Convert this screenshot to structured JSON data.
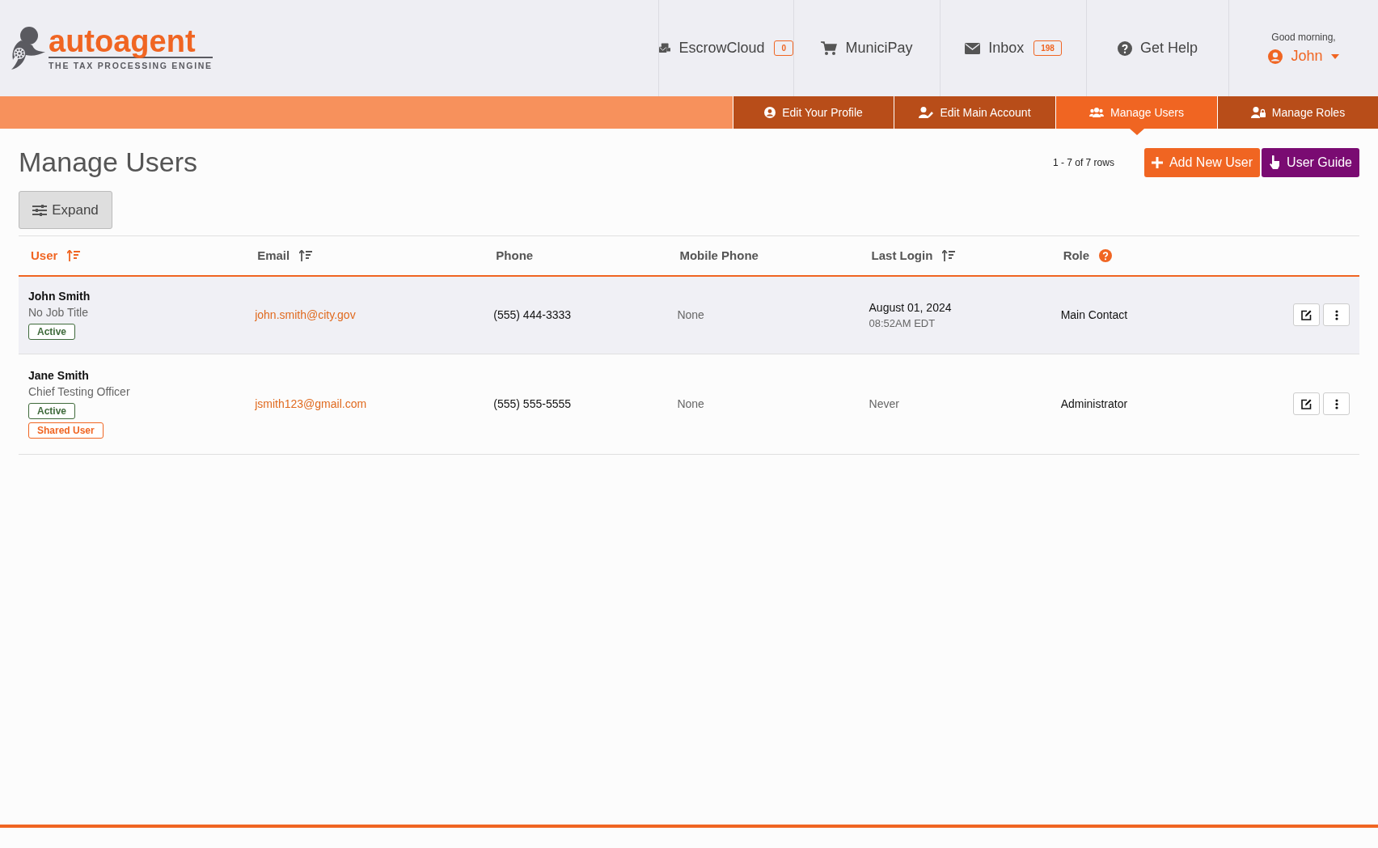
{
  "logo": {
    "name": "autoagent",
    "tagline": "THE TAX PROCESSING ENGINE"
  },
  "top_nav": [
    {
      "kind": "escrow",
      "label": "EscrowCloud",
      "badge": "0"
    },
    {
      "kind": "cart",
      "label": "MuniciPay"
    },
    {
      "kind": "mail",
      "label": "Inbox",
      "badge": "198"
    },
    {
      "kind": "help",
      "label": "Get Help"
    }
  ],
  "user_menu": {
    "greeting": "Good morning,",
    "name": "John"
  },
  "tabs": [
    {
      "kind": "profile",
      "label": "Edit Your Profile",
      "selected": false
    },
    {
      "kind": "account",
      "label": "Edit Main Account",
      "selected": false
    },
    {
      "kind": "users",
      "label": "Manage Users",
      "selected": true
    },
    {
      "kind": "roles",
      "label": "Manage Roles",
      "selected": false
    }
  ],
  "page_title": "Manage Users",
  "row_count": "1 - 7 of 7 rows",
  "buttons": [
    {
      "kind": "add",
      "label": "Add New User"
    },
    {
      "kind": "guide",
      "label": "User Guide"
    }
  ],
  "expand_button": "Expand",
  "table": {
    "columns": [
      {
        "label": "User",
        "kind": "sort",
        "selected": true
      },
      {
        "label": "Email",
        "kind": "sort",
        "selected": false
      },
      {
        "label": "Phone",
        "kind": "plain",
        "selected": false
      },
      {
        "label": "Mobile Phone",
        "kind": "plain",
        "selected": false
      },
      {
        "label": "Last Login",
        "kind": "sort",
        "selected": false
      },
      {
        "label": "Role",
        "kind": "help",
        "selected": false
      }
    ],
    "rows": [
      {
        "highlighted": true,
        "name": "John Smith",
        "job_title": "No Job Title",
        "badges": [
          {
            "kind": "status",
            "label": "Active"
          }
        ],
        "email": "john.smith@city.gov",
        "phone": "(555) 444-3333",
        "mobile_phone": "None",
        "last_login": {
          "date": "August 01, 2024",
          "time": "08:52AM EDT"
        },
        "role": "Main Contact"
      },
      {
        "highlighted": false,
        "name": "Jane Smith",
        "job_title": "Chief Testing Officer",
        "badges": [
          {
            "kind": "status",
            "label": "Active"
          },
          {
            "kind": "shared",
            "label": "Shared User"
          }
        ],
        "email": "jsmith123@gmail.com",
        "phone": "(555) 555-5555",
        "mobile_phone": "None",
        "last_login": {
          "never": "Never"
        },
        "role": "Administrator"
      }
    ]
  }
}
